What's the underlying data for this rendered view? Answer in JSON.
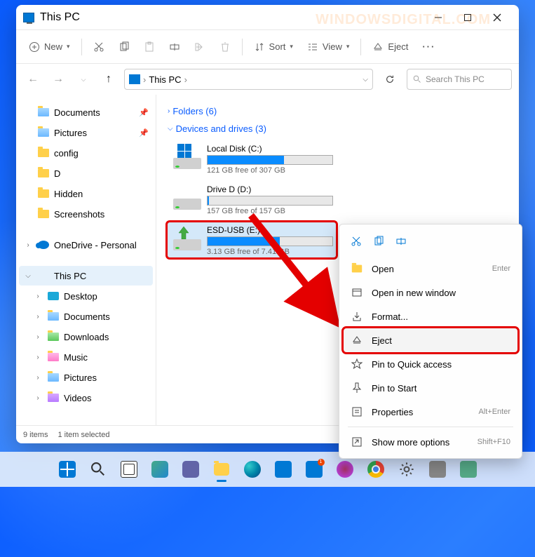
{
  "titlebar": {
    "title": "This PC"
  },
  "toolbar": {
    "new_label": "New",
    "sort_label": "Sort",
    "view_label": "View",
    "eject_label": "Eject"
  },
  "navbar": {
    "breadcrumb": "This PC",
    "search_placeholder": "Search This PC"
  },
  "sidebar": {
    "items": [
      {
        "label": "Documents",
        "pinned": true,
        "icon": "folder-doc"
      },
      {
        "label": "Pictures",
        "pinned": true,
        "icon": "folder-pic"
      },
      {
        "label": "config",
        "icon": "folder"
      },
      {
        "label": "D",
        "icon": "folder"
      },
      {
        "label": "Hidden",
        "icon": "folder"
      },
      {
        "label": "Screenshots",
        "icon": "folder"
      }
    ],
    "onedrive_label": "OneDrive - Personal",
    "thispc_label": "This PC",
    "children": [
      {
        "label": "Desktop",
        "icon": "desk"
      },
      {
        "label": "Documents",
        "icon": "folder-doc"
      },
      {
        "label": "Downloads",
        "icon": "folder-dl"
      },
      {
        "label": "Music",
        "icon": "folder-mus"
      },
      {
        "label": "Pictures",
        "icon": "folder-pic"
      },
      {
        "label": "Videos",
        "icon": "folder-vid"
      }
    ]
  },
  "content": {
    "folders_header": "Folders (6)",
    "drives_header": "Devices and drives (3)",
    "drives": [
      {
        "name": "Local Disk (C:)",
        "free": "121 GB free of 307 GB",
        "fill_pct": 61
      },
      {
        "name": "Drive D (D:)",
        "free": "157 GB free of 157 GB",
        "fill_pct": 1
      },
      {
        "name": "ESD-USB (E:)",
        "free": "3.13 GB free of 7.41 GB",
        "fill_pct": 58,
        "selected": true
      }
    ]
  },
  "context_menu": {
    "items": [
      {
        "label": "Open",
        "shortcut": "Enter",
        "icon": "folder"
      },
      {
        "label": "Open in new window",
        "icon": "window"
      },
      {
        "label": "Format...",
        "icon": "format"
      },
      {
        "label": "Eject",
        "icon": "eject",
        "highlight": true
      },
      {
        "label": "Pin to Quick access",
        "icon": "star"
      },
      {
        "label": "Pin to Start",
        "icon": "pin"
      },
      {
        "label": "Properties",
        "shortcut": "Alt+Enter",
        "icon": "props"
      },
      {
        "label": "Show more options",
        "shortcut": "Shift+F10",
        "icon": "more"
      }
    ]
  },
  "status": {
    "items_text": "9 items",
    "selected_text": "1 item selected"
  },
  "watermark": "WINDOWSDIGITAL.COM"
}
